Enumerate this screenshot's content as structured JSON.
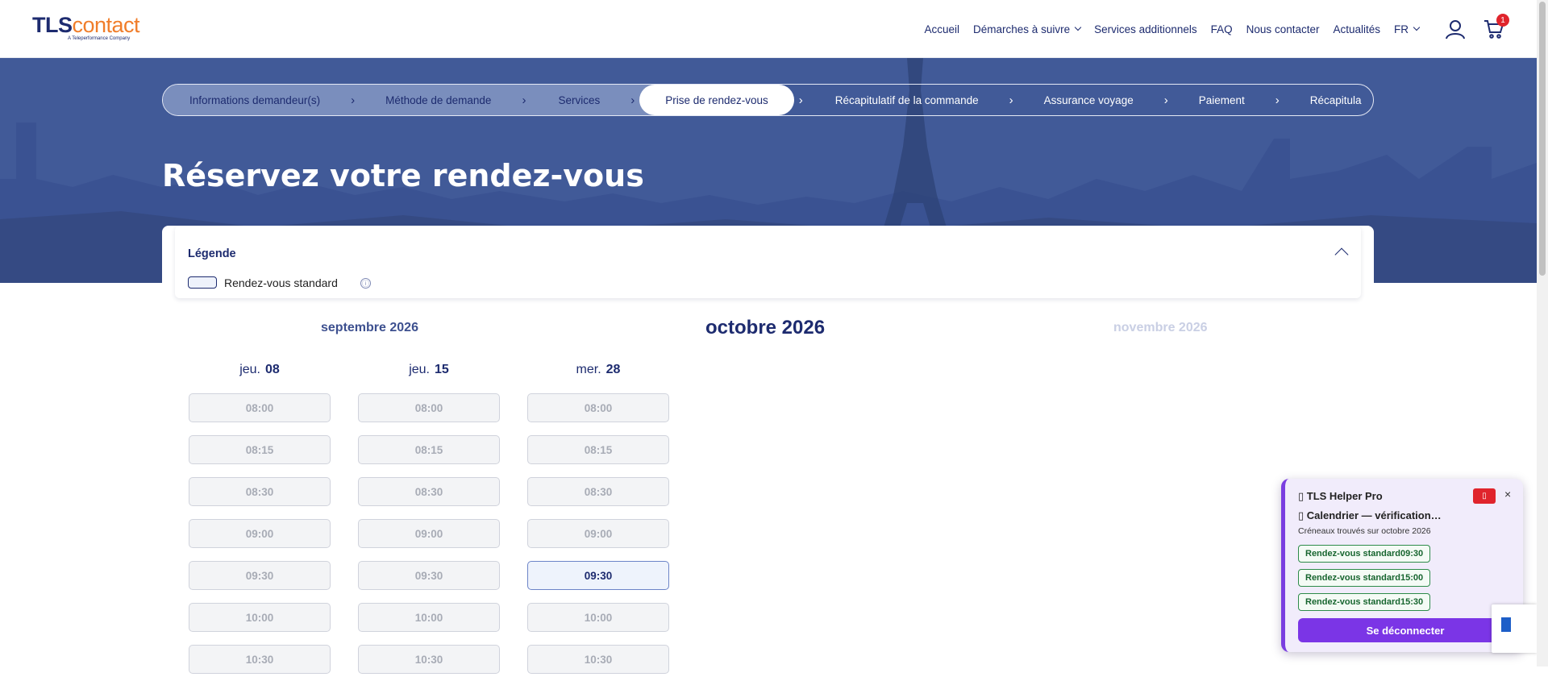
{
  "header": {
    "logo": {
      "brand_main": "TLS",
      "brand_accent": "contact",
      "tagline": "A Teleperformance Company"
    },
    "nav": [
      {
        "label": "Accueil"
      },
      {
        "label": "Démarches à suivre",
        "has_dropdown": true
      },
      {
        "label": "Services additionnels"
      },
      {
        "label": "FAQ"
      },
      {
        "label": "Nous contacter"
      },
      {
        "label": "Actualités"
      },
      {
        "label": "FR",
        "has_dropdown": true
      }
    ],
    "cart_count": "1",
    "icons": {
      "account": "user-icon",
      "cart": "cart-icon"
    }
  },
  "stepper": {
    "steps": [
      {
        "label": "Informations demandeur(s)",
        "state": "done"
      },
      {
        "label": "Méthode de demande",
        "state": "done"
      },
      {
        "label": "Services",
        "state": "done"
      },
      {
        "label": "Prise de rendez-vous",
        "state": "active"
      },
      {
        "label": "Récapitulatif de la commande",
        "state": "todo"
      },
      {
        "label": "Assurance voyage",
        "state": "todo"
      },
      {
        "label": "Paiement",
        "state": "todo"
      },
      {
        "label": "Récapitula",
        "state": "todo"
      }
    ],
    "separator": "›"
  },
  "page_title": "Réservez votre rendez-vous",
  "legend": {
    "title": "Légende",
    "items": [
      {
        "label": "Rendez-vous standard",
        "info_icon": "ⓘ"
      }
    ]
  },
  "calendar": {
    "prev_month": "septembre 2026",
    "current_month": "octobre 2026",
    "next_month": "novembre 2026",
    "days": [
      {
        "weekday": "jeu.",
        "day": "08",
        "slots": [
          {
            "time": "08:00",
            "available": false
          },
          {
            "time": "08:15",
            "available": false
          },
          {
            "time": "08:30",
            "available": false
          },
          {
            "time": "09:00",
            "available": false
          },
          {
            "time": "09:30",
            "available": false
          },
          {
            "time": "10:00",
            "available": false
          },
          {
            "time": "10:30",
            "available": false
          }
        ]
      },
      {
        "weekday": "jeu.",
        "day": "15",
        "slots": [
          {
            "time": "08:00",
            "available": false
          },
          {
            "time": "08:15",
            "available": false
          },
          {
            "time": "08:30",
            "available": false
          },
          {
            "time": "09:00",
            "available": false
          },
          {
            "time": "09:30",
            "available": false
          },
          {
            "time": "10:00",
            "available": false
          },
          {
            "time": "10:30",
            "available": false
          }
        ]
      },
      {
        "weekday": "mer.",
        "day": "28",
        "slots": [
          {
            "time": "08:00",
            "available": false
          },
          {
            "time": "08:15",
            "available": false
          },
          {
            "time": "08:30",
            "available": false
          },
          {
            "time": "09:00",
            "available": false
          },
          {
            "time": "09:30",
            "available": true
          },
          {
            "time": "10:00",
            "available": false
          },
          {
            "time": "10:30",
            "available": false
          }
        ]
      }
    ]
  },
  "helper": {
    "title": "▯ TLS Helper Pro",
    "close": "×",
    "red_button_icon": "▯",
    "status": "▯ Calendrier — vérification…",
    "subtitle": "Créneaux trouvés sur octobre 2026",
    "found": [
      "Rendez-vous standard09:30",
      "Rendez-vous standard15:00",
      "Rendez-vous standard15:30"
    ],
    "logout": "Se déconnecter"
  },
  "colors": {
    "navy": "#1d2b6f",
    "orange": "#f07d2a",
    "hero_blue": "#4660a0",
    "helper_purple": "#7b35e6",
    "found_green": "#2e8b4a",
    "badge_red": "#e0242c"
  }
}
